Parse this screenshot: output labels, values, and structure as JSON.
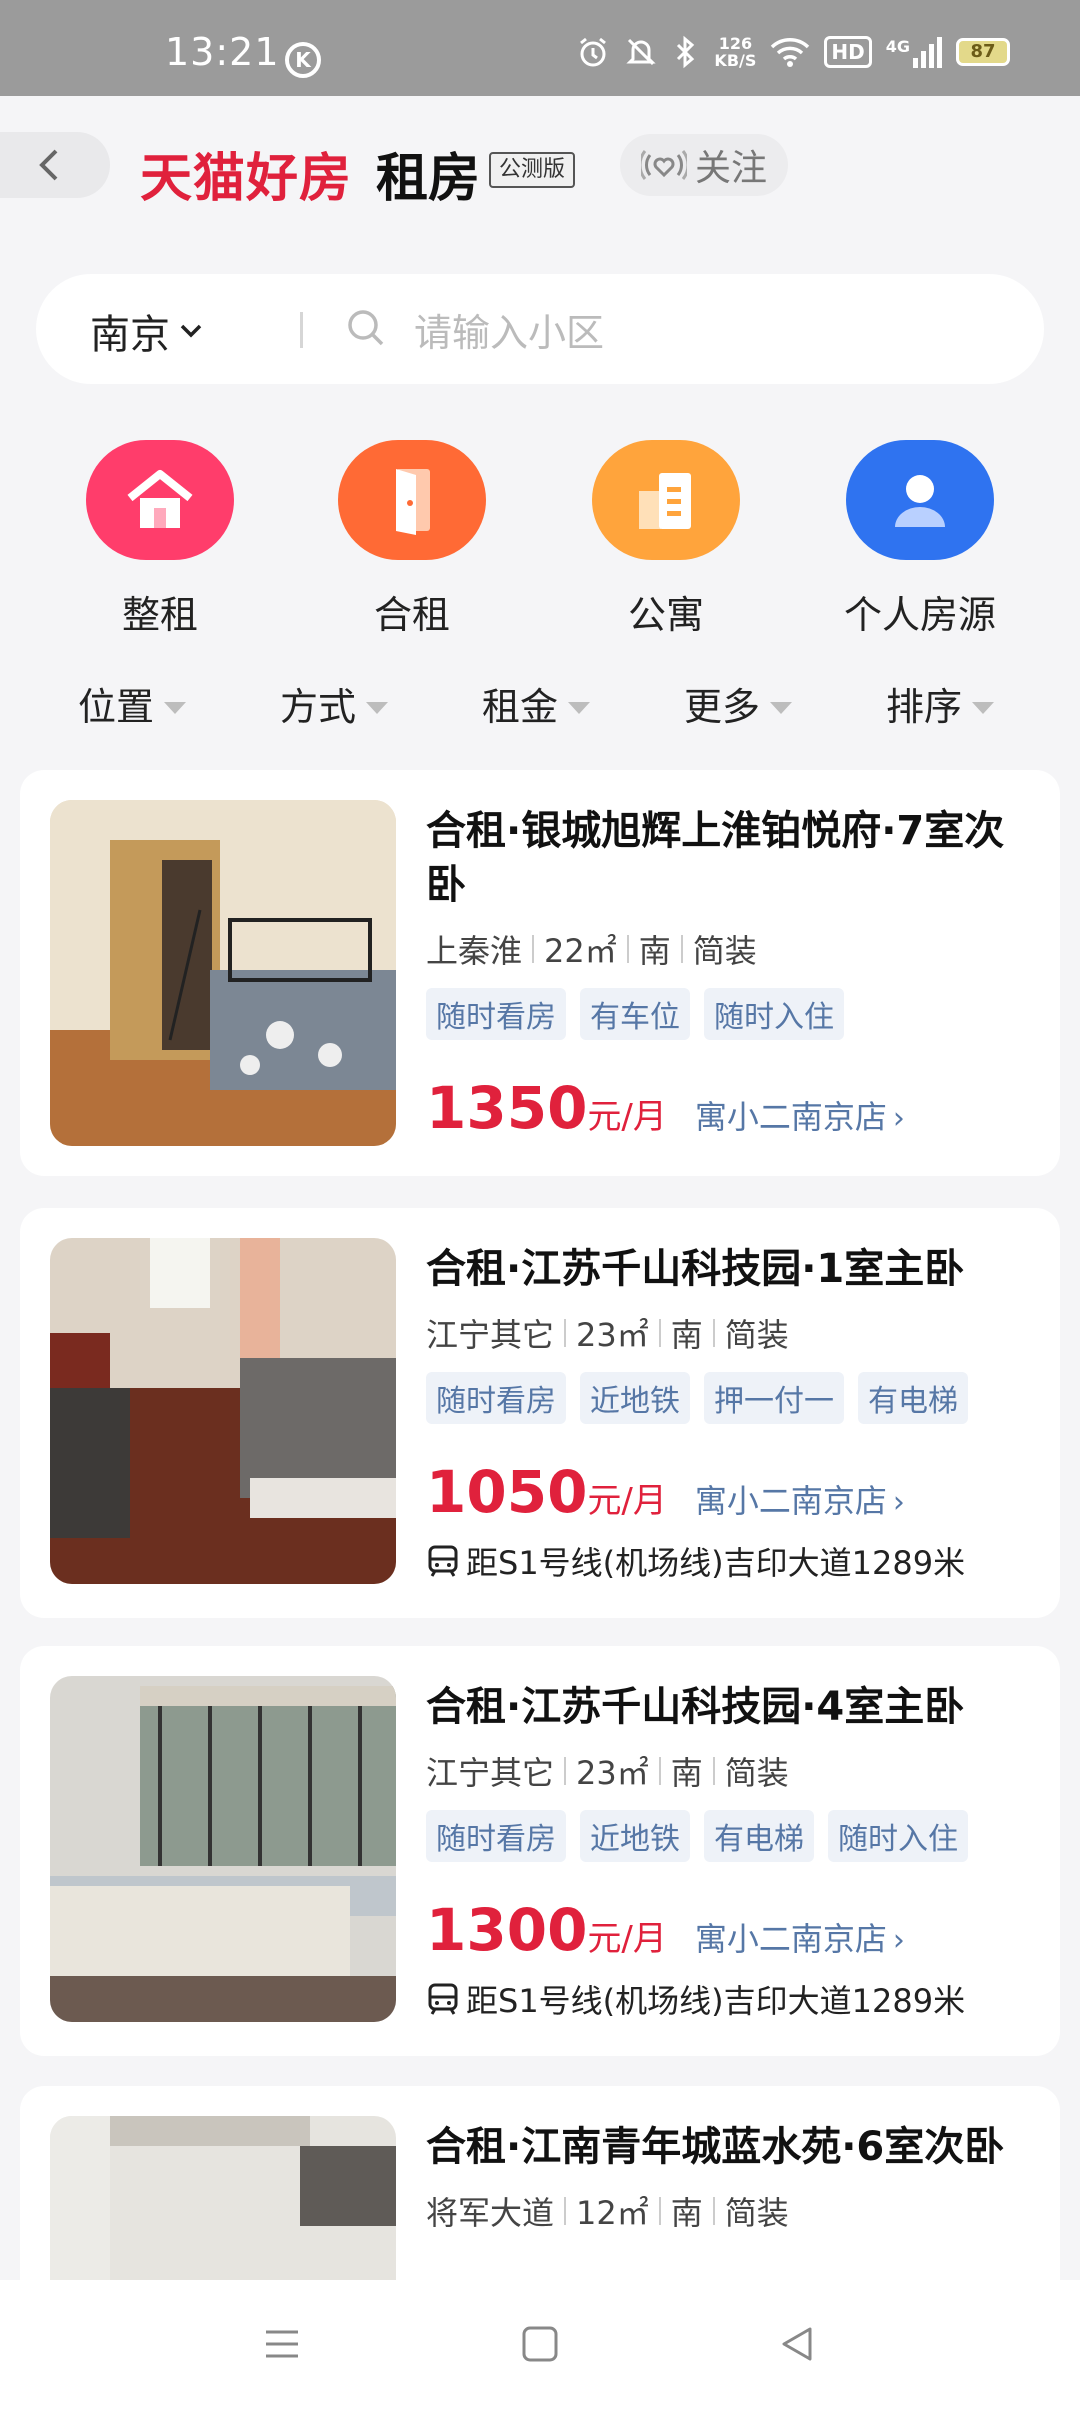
{
  "status": {
    "time": "13:21",
    "k_icon": "K",
    "net_speed_value": "126",
    "net_speed_unit": "KB/S",
    "hd": "HD",
    "signal": "4G",
    "battery": "87"
  },
  "header": {
    "brand": "天猫好房",
    "brand_sub": "租房",
    "beta": "公测版",
    "follow": "关注"
  },
  "search": {
    "city": "南京",
    "placeholder": "请输入小区"
  },
  "categories": [
    {
      "label": "整租",
      "color": "#ff3d6b",
      "icon": "house-icon"
    },
    {
      "label": "合租",
      "color": "#ff6a35",
      "icon": "door-icon"
    },
    {
      "label": "公寓",
      "color": "#ffa43c",
      "icon": "apartment-icon"
    },
    {
      "label": "个人房源",
      "color": "#2f73f0",
      "icon": "person-icon"
    }
  ],
  "filters": [
    "位置",
    "方式",
    "租金",
    "更多",
    "排序"
  ],
  "listings": [
    {
      "title": "合租·银城旭辉上淮铂悦府·7室次卧",
      "district": "上秦淮",
      "area": "22㎡",
      "facing": "南",
      "decor": "简装",
      "tags": [
        "随时看房",
        "有车位",
        "随时入住"
      ],
      "price": "1350",
      "unit": "元/月",
      "store": "寓小二南京店",
      "metro": ""
    },
    {
      "title": "合租·江苏千山科技园·1室主卧",
      "district": "江宁其它",
      "area": "23㎡",
      "facing": "南",
      "decor": "简装",
      "tags": [
        "随时看房",
        "近地铁",
        "押一付一",
        "有电梯"
      ],
      "price": "1050",
      "unit": "元/月",
      "store": "寓小二南京店",
      "metro": "距S1号线(机场线)吉印大道1289米"
    },
    {
      "title": "合租·江苏千山科技园·4室主卧",
      "district": "江宁其它",
      "area": "23㎡",
      "facing": "南",
      "decor": "简装",
      "tags": [
        "随时看房",
        "近地铁",
        "有电梯",
        "随时入住"
      ],
      "price": "1300",
      "unit": "元/月",
      "store": "寓小二南京店",
      "metro": "距S1号线(机场线)吉印大道1289米"
    },
    {
      "title": "合租·江南青年城蓝水苑·6室次卧",
      "district": "将军大道",
      "area": "12㎡",
      "facing": "南",
      "decor": "简装",
      "tags": [],
      "price": "",
      "unit": "",
      "store": "",
      "metro": ""
    }
  ],
  "colors": {
    "brand_red": "#e0213c",
    "link_blue": "#5677a6",
    "tag_bg": "#eef2f8"
  }
}
